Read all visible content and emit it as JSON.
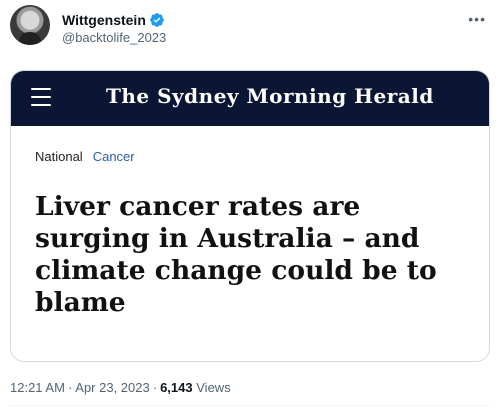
{
  "tweet": {
    "display_name": "Wittgenstein",
    "handle": "@backtolife_2023",
    "more_icon": "more-horizontal-icon",
    "verified_icon": "verified-badge-icon",
    "verified_color": "#1d9bf0"
  },
  "card": {
    "masthead_title": "The Sydney Morning Herald",
    "masthead_color": "#0a1633",
    "menu_icon": "hamburger-menu-icon",
    "section": "National",
    "topic": "Cancer",
    "topic_color": "#2b5fa8",
    "headline": "Liver cancer rates are surging in Australia – and climate change could be to blame"
  },
  "meta": {
    "time": "12:21 AM",
    "date": "Apr 23, 2023",
    "views_count": "6,143",
    "views_label": "Views"
  }
}
